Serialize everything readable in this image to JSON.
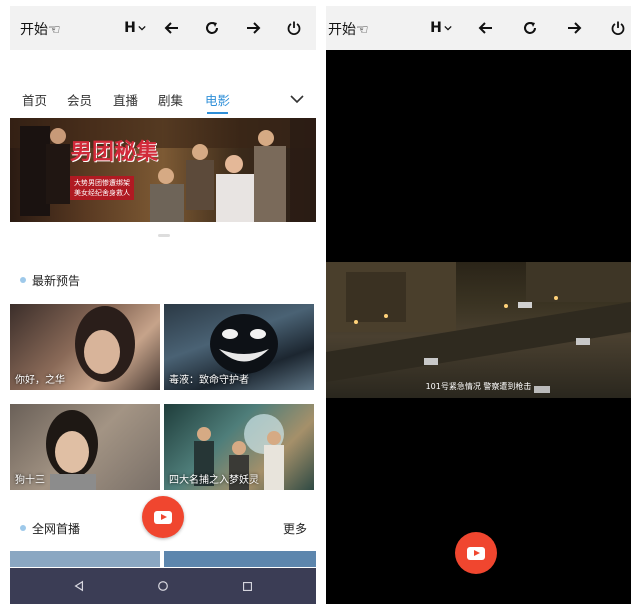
{
  "left_screen": {
    "topbar": {
      "start_label": "开始☜",
      "h_label": "H"
    },
    "tabs": [
      {
        "label": "首页",
        "active": false
      },
      {
        "label": "会员",
        "active": false
      },
      {
        "label": "直播",
        "active": false
      },
      {
        "label": "剧集",
        "active": false
      },
      {
        "label": "电影",
        "active": true
      }
    ],
    "banner": {
      "title": "男团秘集",
      "subtitle_line1": "大势男团惨遭绑架",
      "subtitle_line2": "美女经纪舍身救人"
    },
    "section_latest": {
      "title": "最新预告"
    },
    "cards": [
      {
        "caption": "你好，之华"
      },
      {
        "caption": "毒液：致命守护者"
      },
      {
        "caption": "狗十三"
      },
      {
        "caption": "四大名捕之入梦妖灵"
      }
    ],
    "section_premiere": {
      "title": "全网首播",
      "more_label": "更多"
    }
  },
  "right_screen": {
    "topbar": {
      "start_label": "开始☜",
      "h_label": "H"
    },
    "video": {
      "subtitle": "101号紧急情况 警察遭到枪击"
    }
  },
  "colors": {
    "accent": "#2f8fd8",
    "fab": "#f0462f",
    "navbar": "#3b3d55",
    "topbar": "#f2f2f2"
  }
}
